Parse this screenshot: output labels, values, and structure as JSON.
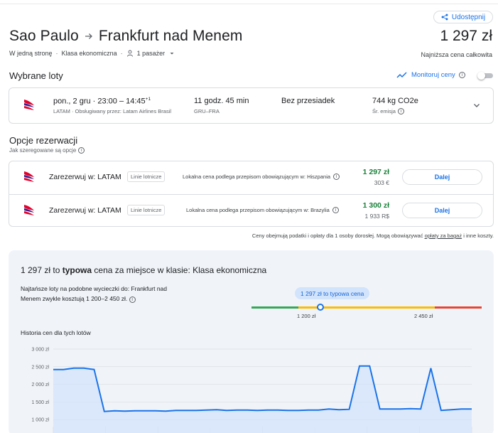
{
  "header": {
    "share_label": "Udostępnij",
    "origin": "Sao Paulo",
    "destination": "Frankfurt nad Menem",
    "total_price": "1 297 zł",
    "trip_type": "W jedną stronę",
    "cabin": "Klasa ekonomiczna",
    "passengers": "1 pasażer",
    "lowest_price_label": "Najniższa cena całkowita"
  },
  "selected": {
    "title": "Wybrane loty",
    "monitor_label": "Monitoruj ceny",
    "monitor_enabled": false,
    "flight": {
      "date_time": "pon., 2 gru · 23:00 – 14:45",
      "day_offset": "+1",
      "airline_line": "LATAM · Obsługiwany przez: Latam Airlines Brasil",
      "duration": "11 godz. 45 min",
      "airports": "GRU–FRA",
      "stops": "Bez przesiadek",
      "emissions": "744 kg CO2e",
      "emissions_note": "Śr. emisja"
    }
  },
  "booking": {
    "title": "Opcje rezerwacji",
    "sort_note": "Jak szeregowane są opcje",
    "options": [
      {
        "label": "Zarezerwuj w: LATAM",
        "chip": "Linie lotnicze",
        "local_note": "Lokalna cena podlega przepisom obowiązującym w: Hiszpania",
        "price": "1 297 zł",
        "alt_price": "303 €",
        "button": "Dalej"
      },
      {
        "label": "Zarezerwuj w: LATAM",
        "chip": "Linie lotnicze",
        "local_note": "Lokalna cena podlega przepisom obowiązującym w: Brazylia",
        "price": "1 300 zł",
        "alt_price": "1 933 R$",
        "button": "Dalej"
      }
    ],
    "disclaimer_pre": "Ceny obejmują podatki i opłaty dla 1 osoby dorosłej. Mogą obowiązywać ",
    "disclaimer_link": "opłaty za bagaż",
    "disclaimer_post": " i inne koszty."
  },
  "insights": {
    "title_pre": "1 297 zł to ",
    "title_bold": "typowa",
    "title_post": " cena za miejsce w klasie: Klasa ekonomiczna",
    "description": "Najtańsze loty na podobne wycieczki do: Frankfurt nad Menem zwykle kosztują 1 200–2 450 zł.",
    "bubble": "1 297 zł to typowa cena",
    "range_low": "1 200 zł",
    "range_high": "2 450 zł",
    "current_price_value": 1297,
    "colors": {
      "low": "#34a853",
      "typical": "#fbbc04",
      "high": "#ea4335",
      "accent": "#1a73e8"
    },
    "history_title": "Historia cen dla tych lotów"
  },
  "chart_data": {
    "type": "area",
    "title": "Historia cen dla tych lotów",
    "ylim": [
      800,
      3000
    ],
    "yticks": [
      3000,
      2500,
      2000,
      1500,
      1000
    ],
    "ytick_labels": [
      "3 000 zł",
      "2 500 zł",
      "2 000 zł",
      "1 500 zł",
      "1 000 zł"
    ],
    "grid": true,
    "values": [
      2420,
      2420,
      2460,
      2460,
      2420,
      1230,
      1250,
      1240,
      1250,
      1250,
      1250,
      1240,
      1260,
      1260,
      1260,
      1270,
      1280,
      1260,
      1270,
      1270,
      1260,
      1270,
      1270,
      1260,
      1260,
      1270,
      1270,
      1300,
      1280,
      1290,
      2520,
      2520,
      1300,
      1300,
      1300,
      1310,
      1300,
      2460,
      1260,
      1280,
      1300,
      1300
    ]
  }
}
